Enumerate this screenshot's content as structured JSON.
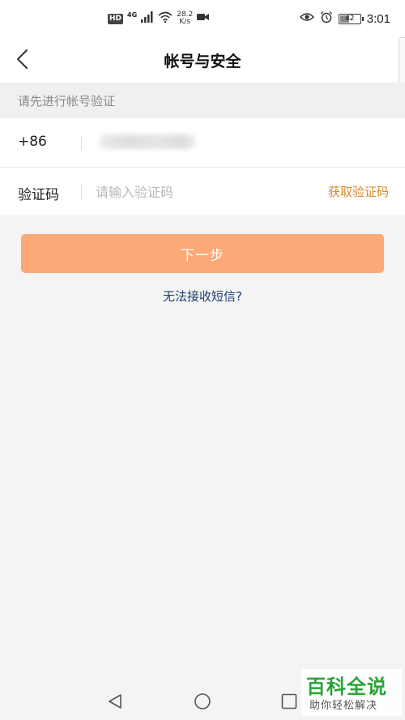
{
  "status_bar": {
    "hd": "HD",
    "network": "4G",
    "speed_value": "28.2",
    "speed_unit": "K/s",
    "battery": "42",
    "battery_level": 0.42,
    "time": "3:01"
  },
  "header": {
    "title": "帐号与安全"
  },
  "hint": "请先进行帐号验证",
  "form": {
    "country_code": "+86",
    "code_label": "验证码",
    "code_placeholder": "请输入验证码",
    "get_code": "获取验证码"
  },
  "actions": {
    "next": "下一步",
    "no_sms": "无法接收短信?"
  },
  "watermark": {
    "title": "百科全说",
    "subtitle": "助你轻松解决"
  },
  "colors": {
    "accent": "#fda877",
    "get_code": "#d98a2a",
    "link": "#1f3f73",
    "watermark": "#29a33a"
  }
}
